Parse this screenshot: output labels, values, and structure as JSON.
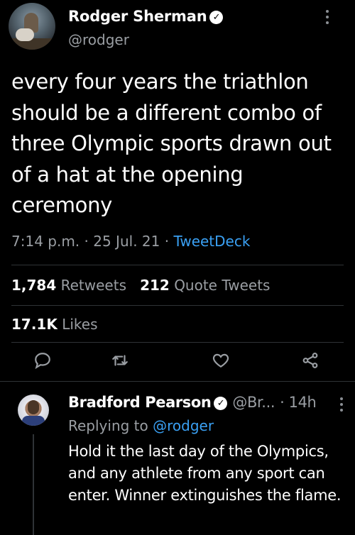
{
  "main_tweet": {
    "author_name": "Rodger Sherman",
    "handle": "@rodger",
    "text": "every four years the triathlon should be a different combo of three Olympic sports drawn out of a hat at the opening ceremony",
    "time": "7:14 p.m.",
    "date": "25 Jul. 21",
    "source": "TweetDeck",
    "separator": "·"
  },
  "stats": {
    "retweets_count": "1,784",
    "retweets_label": "Retweets",
    "quotes_count": "212",
    "quotes_label": "Quote Tweets",
    "likes_count": "17.1K",
    "likes_label": "Likes"
  },
  "actions": {
    "reply_icon": "reply-icon",
    "retweet_icon": "retweet-icon",
    "like_icon": "heart-icon",
    "share_icon": "share-icon"
  },
  "reply": {
    "author_name": "Bradford Pearson",
    "handle": "@Br...",
    "time_ago": "· 14h",
    "replying_to_label": "Replying to",
    "replying_to_handle": "@rodger",
    "text": "Hold it the last day of the Olympics, and any athlete from any sport can enter. Winner extinguishes the flame."
  },
  "colors": {
    "background": "#000000",
    "text": "#ffffff",
    "secondary": "#9a9ea3",
    "accent": "#3aa0f3",
    "divider": "#2f3336"
  }
}
